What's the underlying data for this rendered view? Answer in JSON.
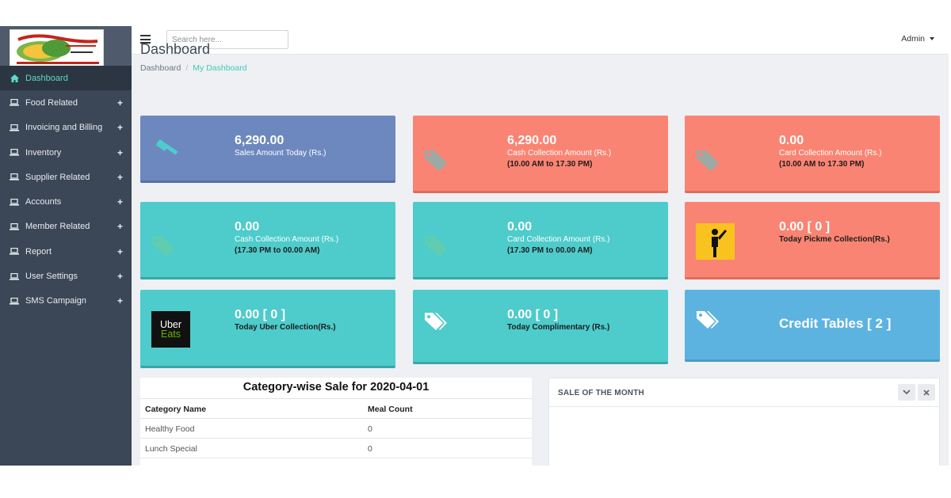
{
  "header": {
    "search_placeholder": "Search here...",
    "user_label": "Admin"
  },
  "sidebar": {
    "items": [
      {
        "label": "Dashboard",
        "icon": "home-icon",
        "active": true
      },
      {
        "label": "Food Related",
        "icon": "laptop-icon",
        "expand": "+"
      },
      {
        "label": "Invoicing and Billing",
        "icon": "laptop-icon",
        "expand": "+"
      },
      {
        "label": "Inventory",
        "icon": "laptop-icon",
        "expand": "+"
      },
      {
        "label": "Supplier Related",
        "icon": "laptop-icon",
        "expand": "+"
      },
      {
        "label": "Accounts",
        "icon": "laptop-icon",
        "expand": "+"
      },
      {
        "label": "Member Related",
        "icon": "laptop-icon",
        "expand": "+"
      },
      {
        "label": "Report",
        "icon": "laptop-icon",
        "expand": "+"
      },
      {
        "label": "User Settings",
        "icon": "laptop-icon",
        "expand": "+"
      },
      {
        "label": "SMS Campaign",
        "icon": "laptop-icon",
        "expand": "+"
      }
    ]
  },
  "page": {
    "title": "Dashboard",
    "breadcrumb": [
      "Dashboard",
      "My Dashboard"
    ]
  },
  "cards": {
    "sales_today": {
      "value": "6,290.00",
      "label": "Sales Amount Today (Rs.)",
      "icon": "gavel-icon"
    },
    "cash_day": {
      "value": "6,290.00",
      "label": "Cash Collection Amount (Rs.)",
      "sub": "(10.00 AM to 17.30 PM)",
      "icon": "tag-icon"
    },
    "card_day": {
      "value": "0.00",
      "label": "Card Collection Amount (Rs.)",
      "sub": "(10.00 AM to 17.30 PM)",
      "icon": "tag-icon"
    },
    "cash_night": {
      "value": "0.00",
      "label": "Cash Collection Amount (Rs.)",
      "sub": "(17.30 PM to 00.00 AM)",
      "icon": "tag-icon"
    },
    "card_night": {
      "value": "0.00",
      "label": "Card Collection Amount (Rs.)",
      "sub": "(17.30 PM to 00.00 AM)",
      "icon": "tag-icon"
    },
    "pickme": {
      "value": "0.00 [ 0 ]",
      "label": "Today Pickme Collection(Rs.)",
      "icon": "pickme-logo"
    },
    "uber": {
      "value": "0.00 [ 0 ]",
      "label": "Today Uber Collection(Rs.)",
      "icon": "uber-eats-logo",
      "logo_line1": "Uber",
      "logo_line2": "Eats"
    },
    "complimentary": {
      "value": "0.00 [ 0 ]",
      "label": "Today Complimentary (Rs.)",
      "icon": "tags-icon"
    },
    "credit_tables": {
      "label": "Credit Tables [ 2 ]",
      "icon": "tags-icon"
    }
  },
  "category_sale": {
    "title": "Category-wise Sale for 2020-04-01",
    "columns": [
      "Category Name",
      "Meal Count"
    ],
    "rows": [
      [
        "Healthy Food",
        "0"
      ],
      [
        "Lunch Special",
        "0"
      ]
    ]
  },
  "sale_of_month": {
    "title": "SALE OF THE MONTH"
  },
  "colors": {
    "sidebar": "#3b4656",
    "active_text": "#5ed8c5",
    "blue_card": "#6c88bf",
    "salmon_card": "#fa8473",
    "teal_card": "#4ecbcb",
    "sky_card": "#5db3e0"
  }
}
